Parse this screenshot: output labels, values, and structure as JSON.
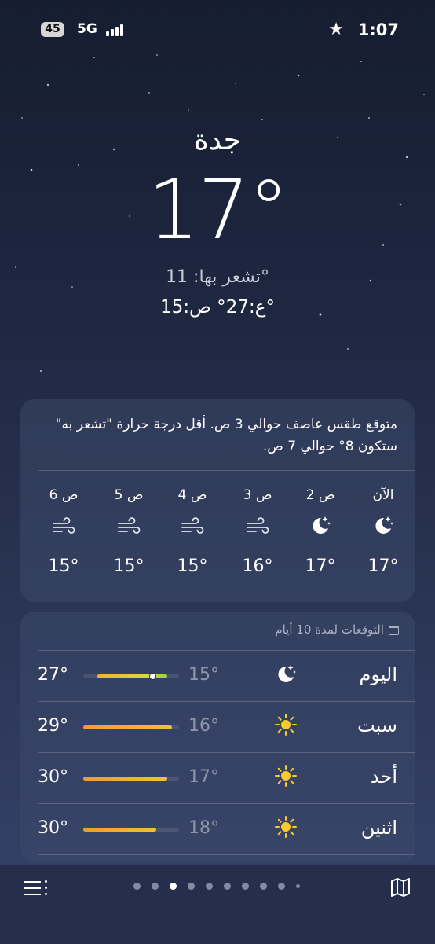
{
  "status": {
    "battery": "45",
    "network": "5G",
    "time": "1:07"
  },
  "hero": {
    "city": "جدة",
    "temperature": "17°",
    "feels_like": "تشعر بها: 11°",
    "high_low": "ع:27°  ص:15°"
  },
  "hourly_card": {
    "summary": "متوقع طقس عاصف حوالي 3 ص. أقل درجة حرارة \"تشعر به\" ستكون 8° حوالي 7 ص.",
    "hours": [
      {
        "label": "الآن",
        "icon": "moon-stars-icon",
        "temp": "17°"
      },
      {
        "label": "2 ص",
        "icon": "moon-stars-icon",
        "temp": "17°"
      },
      {
        "label": "3 ص",
        "icon": "wind-icon",
        "temp": "16°"
      },
      {
        "label": "4 ص",
        "icon": "wind-icon",
        "temp": "15°"
      },
      {
        "label": "5 ص",
        "icon": "wind-icon",
        "temp": "15°"
      },
      {
        "label": "6 ص",
        "icon": "wind-icon",
        "temp": "15°"
      }
    ]
  },
  "forecast": {
    "title": "التوقعات لمدة 10 أيام",
    "days": [
      {
        "day": "اليوم",
        "icon": "moon-stars-icon",
        "low": "15°",
        "high": "27°",
        "bar_start": 0.15,
        "bar_end": 0.88,
        "current_marker": 0.72
      },
      {
        "day": "سبت",
        "icon": "sun-icon",
        "low": "16°",
        "high": "29°",
        "bar_start": 0.0,
        "bar_end": 0.93
      },
      {
        "day": "أحد",
        "icon": "sun-icon",
        "low": "17°",
        "high": "30°",
        "bar_start": 0.0,
        "bar_end": 0.88
      },
      {
        "day": "اثنين",
        "icon": "sun-icon",
        "low": "18°",
        "high": "30°",
        "bar_start": 0.0,
        "bar_end": 0.76
      }
    ]
  },
  "page_dots": {
    "count": 10,
    "current": 3
  },
  "colors": {
    "accent_bar_start": "#f29a2e",
    "accent_bar_end": "#f2c230",
    "background_top": "#161d31"
  }
}
